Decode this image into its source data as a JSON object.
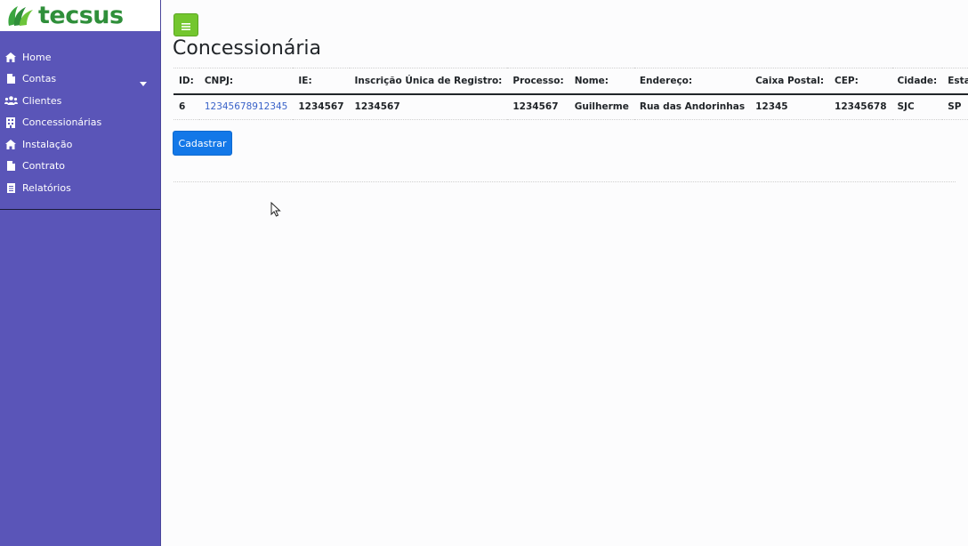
{
  "app": {
    "logo_text": "tecsus"
  },
  "sidebar": {
    "items": [
      {
        "label": "Home",
        "icon": "home-icon"
      },
      {
        "label": "Contas",
        "icon": "file-icon",
        "has_caret": true
      },
      {
        "label": "Clientes",
        "icon": "users-icon"
      },
      {
        "label": "Concessionárias",
        "icon": "building-icon"
      },
      {
        "label": "Instalação",
        "icon": "home-icon"
      },
      {
        "label": "Contrato",
        "icon": "file-icon"
      },
      {
        "label": "Relatórios",
        "icon": "report-icon"
      }
    ]
  },
  "page": {
    "title": "Concessionária",
    "register_button": "Cadastrar"
  },
  "table": {
    "headers": [
      "ID:",
      "CNPJ:",
      "IE:",
      "Inscrição Única de Registro:",
      "Processo:",
      "Nome:",
      "Endereço:",
      "Caixa Postal:",
      "CEP:",
      "Cidade:",
      "Estado:"
    ],
    "rows": [
      {
        "id": "6",
        "cnpj": "12345678912345",
        "ie": "1234567",
        "inscricao": "1234567",
        "processo": "1234567",
        "nome": "Guilherme",
        "endereco": "Rua das Andorinhas",
        "caixa_postal": "12345",
        "cep": "12345678",
        "cidade": "SJC",
        "estado": "SP"
      }
    ]
  },
  "colors": {
    "sidebar": "#5a55b8",
    "toggle_button": "#73c62e",
    "primary_button": "#1378e8",
    "link": "#3a63c9",
    "logo_green": "#2f8f3a"
  }
}
